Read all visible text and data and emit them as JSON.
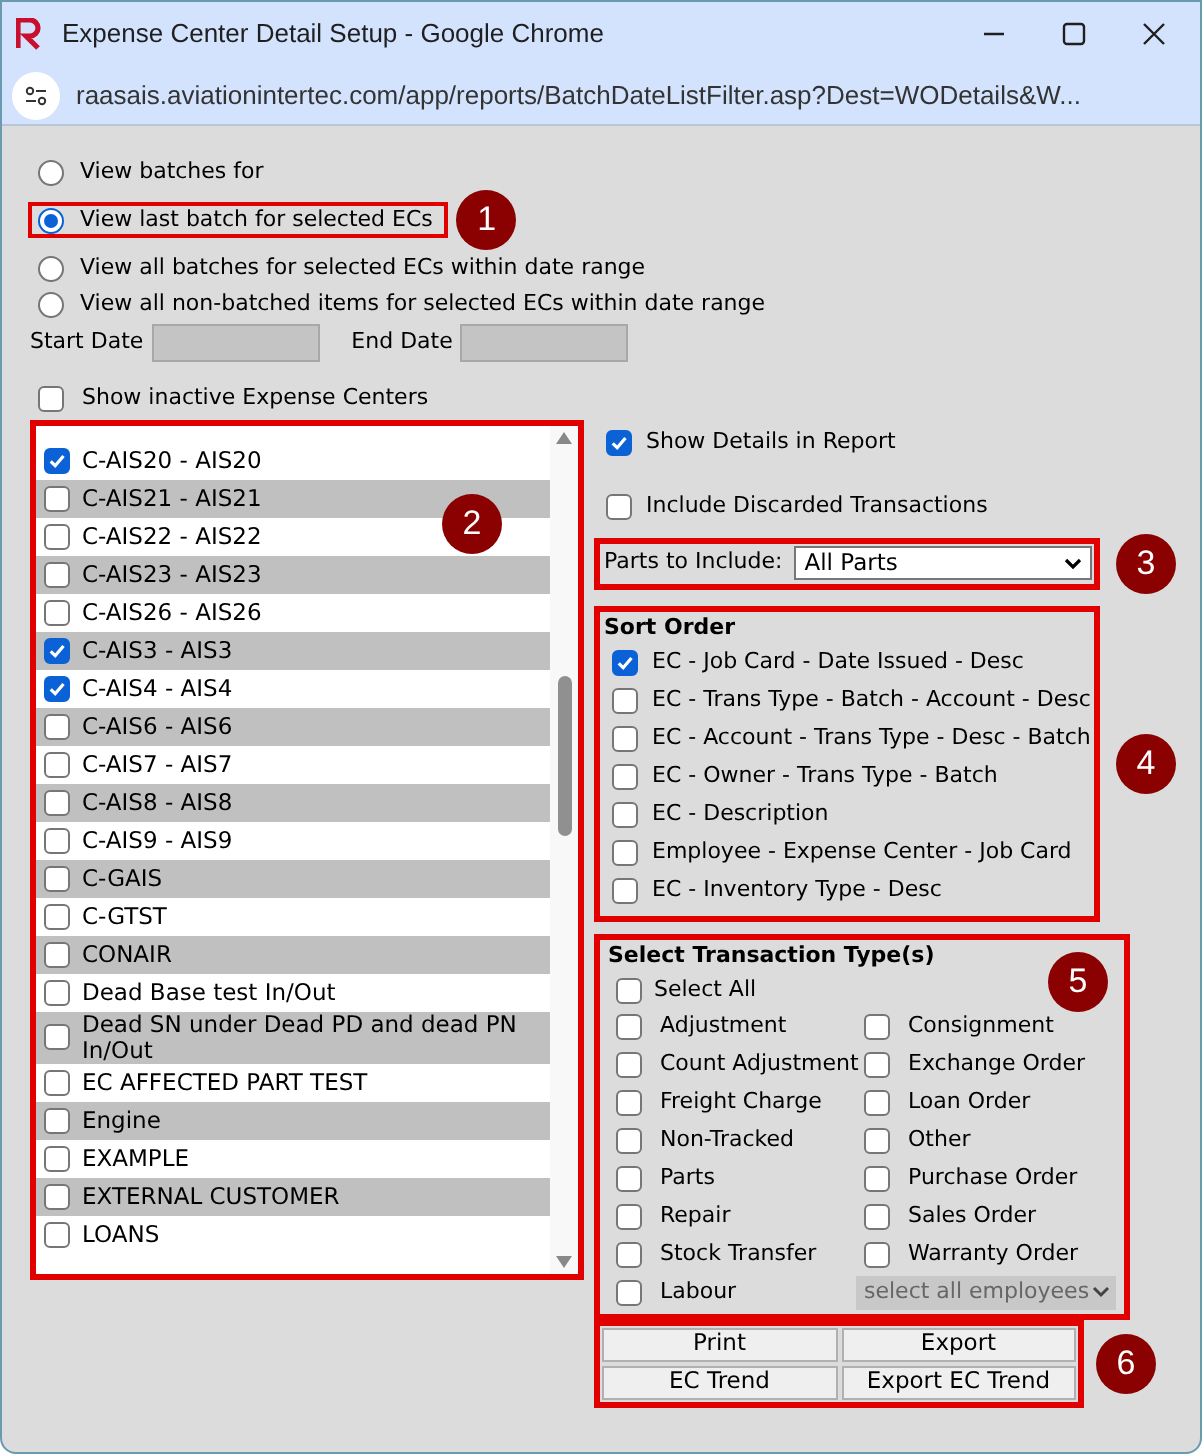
{
  "window": {
    "title": "Expense Center Detail Setup - Google Chrome"
  },
  "address_bar": {
    "url": "raasais.aviationintertec.com/app/reports/BatchDateListFilter.asp?Dest=WODetails&W..."
  },
  "view_options": [
    {
      "label": "View batches for",
      "selected": false
    },
    {
      "label": "View last batch for selected ECs",
      "selected": true
    },
    {
      "label": "View all batches for selected ECs within date range",
      "selected": false
    },
    {
      "label": "View all non-batched items for selected ECs within date range",
      "selected": false
    }
  ],
  "start_date": {
    "label": "Start Date"
  },
  "end_date": {
    "label": "End Date"
  },
  "show_inactive": {
    "label": "Show inactive Expense Centers",
    "checked": false
  },
  "expense_centers": [
    {
      "label": "C-AIS20 - AIS20",
      "checked": true
    },
    {
      "label": "C-AIS21 - AIS21",
      "checked": false
    },
    {
      "label": "C-AIS22 - AIS22",
      "checked": false
    },
    {
      "label": "C-AIS23 - AIS23",
      "checked": false
    },
    {
      "label": "C-AIS26 - AIS26",
      "checked": false
    },
    {
      "label": "C-AIS3 - AIS3",
      "checked": true
    },
    {
      "label": "C-AIS4 - AIS4",
      "checked": true
    },
    {
      "label": "C-AIS6 - AIS6",
      "checked": false
    },
    {
      "label": "C-AIS7 - AIS7",
      "checked": false
    },
    {
      "label": "C-AIS8 - AIS8",
      "checked": false
    },
    {
      "label": "C-AIS9 - AIS9",
      "checked": false
    },
    {
      "label": "C-GAIS",
      "checked": false
    },
    {
      "label": "C-GTST",
      "checked": false
    },
    {
      "label": "CONAIR",
      "checked": false
    },
    {
      "label": "Dead Base test In/Out",
      "checked": false
    },
    {
      "label": "Dead SN under Dead PD and dead PN In/Out",
      "checked": false
    },
    {
      "label": "EC AFFECTED PART TEST",
      "checked": false
    },
    {
      "label": "Engine",
      "checked": false
    },
    {
      "label": "EXAMPLE",
      "checked": false
    },
    {
      "label": "EXTERNAL CUSTOMER",
      "checked": false
    },
    {
      "label": "LOANS",
      "checked": false
    }
  ],
  "show_details": {
    "label": "Show Details in Report",
    "checked": true
  },
  "include_discarded": {
    "label": "Include Discarded Transactions",
    "checked": false
  },
  "parts_to_include": {
    "label": "Parts to Include:",
    "value": "All Parts"
  },
  "sort_order": {
    "title": "Sort Order",
    "options": [
      {
        "label": "EC - Job Card - Date Issued - Desc",
        "checked": true
      },
      {
        "label": "EC - Trans Type - Batch - Account - Desc",
        "checked": false
      },
      {
        "label": "EC - Account - Trans Type - Desc - Batch",
        "checked": false
      },
      {
        "label": "EC - Owner - Trans Type - Batch",
        "checked": false
      },
      {
        "label": "EC - Description",
        "checked": false
      },
      {
        "label": "Employee - Expense Center - Job Card",
        "checked": false
      },
      {
        "label": "EC - Inventory Type - Desc",
        "checked": false
      }
    ]
  },
  "transaction_types": {
    "title": "Select Transaction Type(s)",
    "select_all": {
      "label": "Select All",
      "checked": false
    },
    "items": [
      {
        "label": "Adjustment",
        "checked": false
      },
      {
        "label": "Consignment",
        "checked": false
      },
      {
        "label": "Count Adjustment",
        "checked": false
      },
      {
        "label": "Exchange Order",
        "checked": false
      },
      {
        "label": "Freight Charge",
        "checked": false
      },
      {
        "label": "Loan Order",
        "checked": false
      },
      {
        "label": "Non-Tracked",
        "checked": false
      },
      {
        "label": "Other",
        "checked": false
      },
      {
        "label": "Parts",
        "checked": false
      },
      {
        "label": "Purchase Order",
        "checked": false
      },
      {
        "label": "Repair",
        "checked": false
      },
      {
        "label": "Sales Order",
        "checked": false
      },
      {
        "label": "Stock Transfer",
        "checked": false
      },
      {
        "label": "Warranty Order",
        "checked": false
      },
      {
        "label": "Labour",
        "checked": false
      }
    ],
    "employee_select": {
      "value": "select all employees"
    }
  },
  "buttons": [
    "Print",
    "Export",
    "EC Trend",
    "Export EC Trend"
  ],
  "callouts": [
    "1",
    "2",
    "3",
    "4",
    "5",
    "6"
  ]
}
